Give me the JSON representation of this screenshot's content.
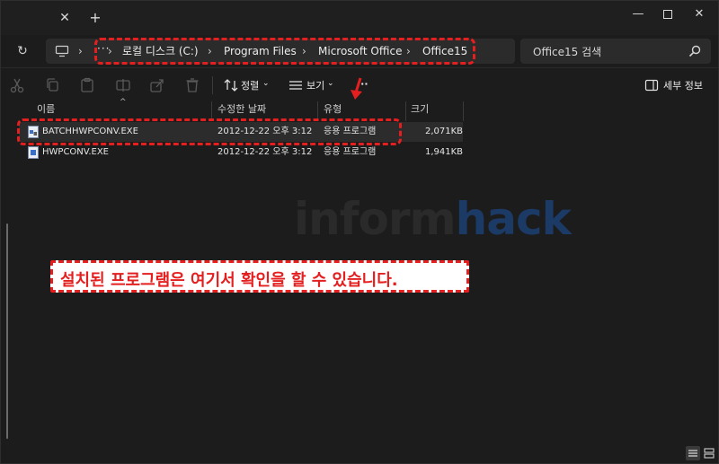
{
  "titlebar": {
    "tab_close_icon": "close-icon",
    "new_tab_icon": "plus-icon",
    "minimize_icon": "minimize-icon",
    "maximize_icon": "maximize-icon",
    "close_icon": "close-icon"
  },
  "address": {
    "overflow": "···",
    "crumbs": [
      "로컬 디스크 (C:)",
      "Program Files",
      "Microsoft Office",
      "Office15"
    ]
  },
  "search": {
    "placeholder": "Office15 검색"
  },
  "toolbar": {
    "sort_label": "정렬",
    "view_label": "보기",
    "more_label": "···",
    "details_label": "세부 정보"
  },
  "columns": {
    "name": "이름",
    "modified": "수정한 날짜",
    "type": "유형",
    "size": "크기"
  },
  "files": [
    {
      "name": "BATCHHWPCONV.EXE",
      "modified": "2012-12-22 오후 3:12",
      "type": "응용 프로그램",
      "size": "2,071KB"
    },
    {
      "name": "HWPCONV.EXE",
      "modified": "2012-12-22 오후 3:12",
      "type": "응용 프로그램",
      "size": "1,941KB"
    }
  ],
  "watermark": {
    "part1": "inform",
    "part2": "hack"
  },
  "callout": {
    "text": "설치된 프로그램은 여기서 확인을 할 수 있습니다."
  },
  "colors": {
    "highlight": "#e41f1f",
    "background": "#1c1c1c",
    "watermark_accent": "#1c3a66"
  }
}
